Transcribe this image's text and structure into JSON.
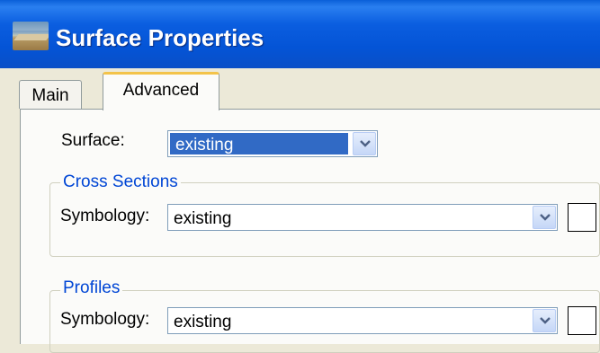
{
  "window": {
    "title": "Surface Properties",
    "icon": "surface-road-icon"
  },
  "tabs": [
    {
      "label": "Main",
      "selected": false
    },
    {
      "label": "Advanced",
      "selected": true
    }
  ],
  "surface": {
    "label": "Surface:",
    "value": "existing"
  },
  "cross_sections": {
    "title": "Cross Sections",
    "symbology_label": "Symbology:",
    "symbology_value": "existing"
  },
  "profiles": {
    "title": "Profiles",
    "symbology_label": "Symbology:",
    "symbology_value": "existing"
  },
  "colors": {
    "titlebar": "#0454d6",
    "selection": "#316ac5",
    "group_title": "#0046d5",
    "tab_highlight": "#f3c34a"
  }
}
